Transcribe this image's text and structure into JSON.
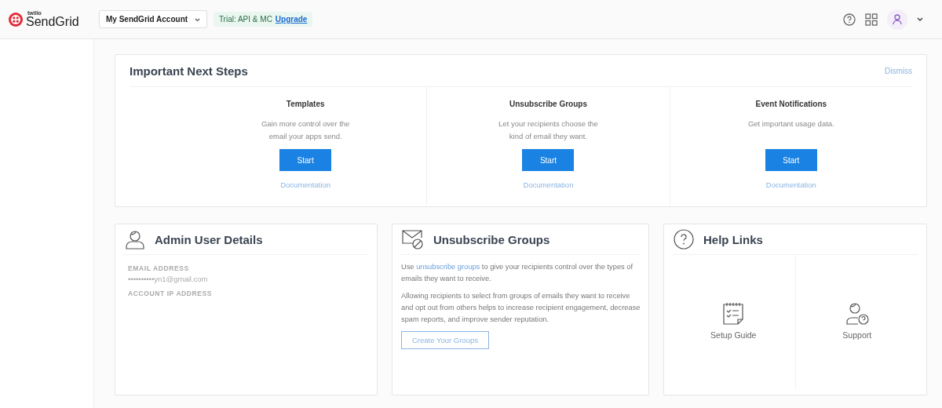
{
  "header": {
    "brand": "SendGrid",
    "brand_small": "twilio",
    "account": "My SendGrid Account",
    "plan": "Trial: API & MC",
    "upgrade": "Upgrade"
  },
  "next_steps": {
    "title": "Important Next Steps",
    "dismiss": "Dismiss",
    "steps": [
      {
        "title": "Templates",
        "lines": [
          "Gain more control over the",
          "email your apps send."
        ],
        "button": "Start",
        "link": "Documentation"
      },
      {
        "title": "Unsubscribe Groups",
        "lines": [
          "Let your recipients choose the",
          "kind of email they want."
        ],
        "button": "Start",
        "link": "Documentation"
      },
      {
        "title": "Event Notifications",
        "lines": [
          "Get important usage data."
        ],
        "button": "Start",
        "link": "Documentation"
      }
    ]
  },
  "admin": {
    "title": "Admin User Details",
    "email_label": "EMAIL ADDRESS",
    "email": "••••••••••yn1@gmail.com",
    "ip_label": "ACCOUNT IP ADDRESS"
  },
  "unsubscribe": {
    "title": "Unsubscribe Groups",
    "pre": "Use",
    "link": "unsubscribe groups",
    "post": "to give your recipients control over the types of emails they want to receive.",
    "para": "Allowing recipients to select from groups of emails they want to receive and opt out from others helps to increase recipient engagement, decrease spam reports, and improve sender reputation.",
    "button": "Create Your Groups"
  },
  "help": {
    "title": "Help Links",
    "links": [
      {
        "kind": "guide",
        "label": "Setup Guide"
      },
      {
        "kind": "support",
        "label": "Support"
      }
    ]
  }
}
